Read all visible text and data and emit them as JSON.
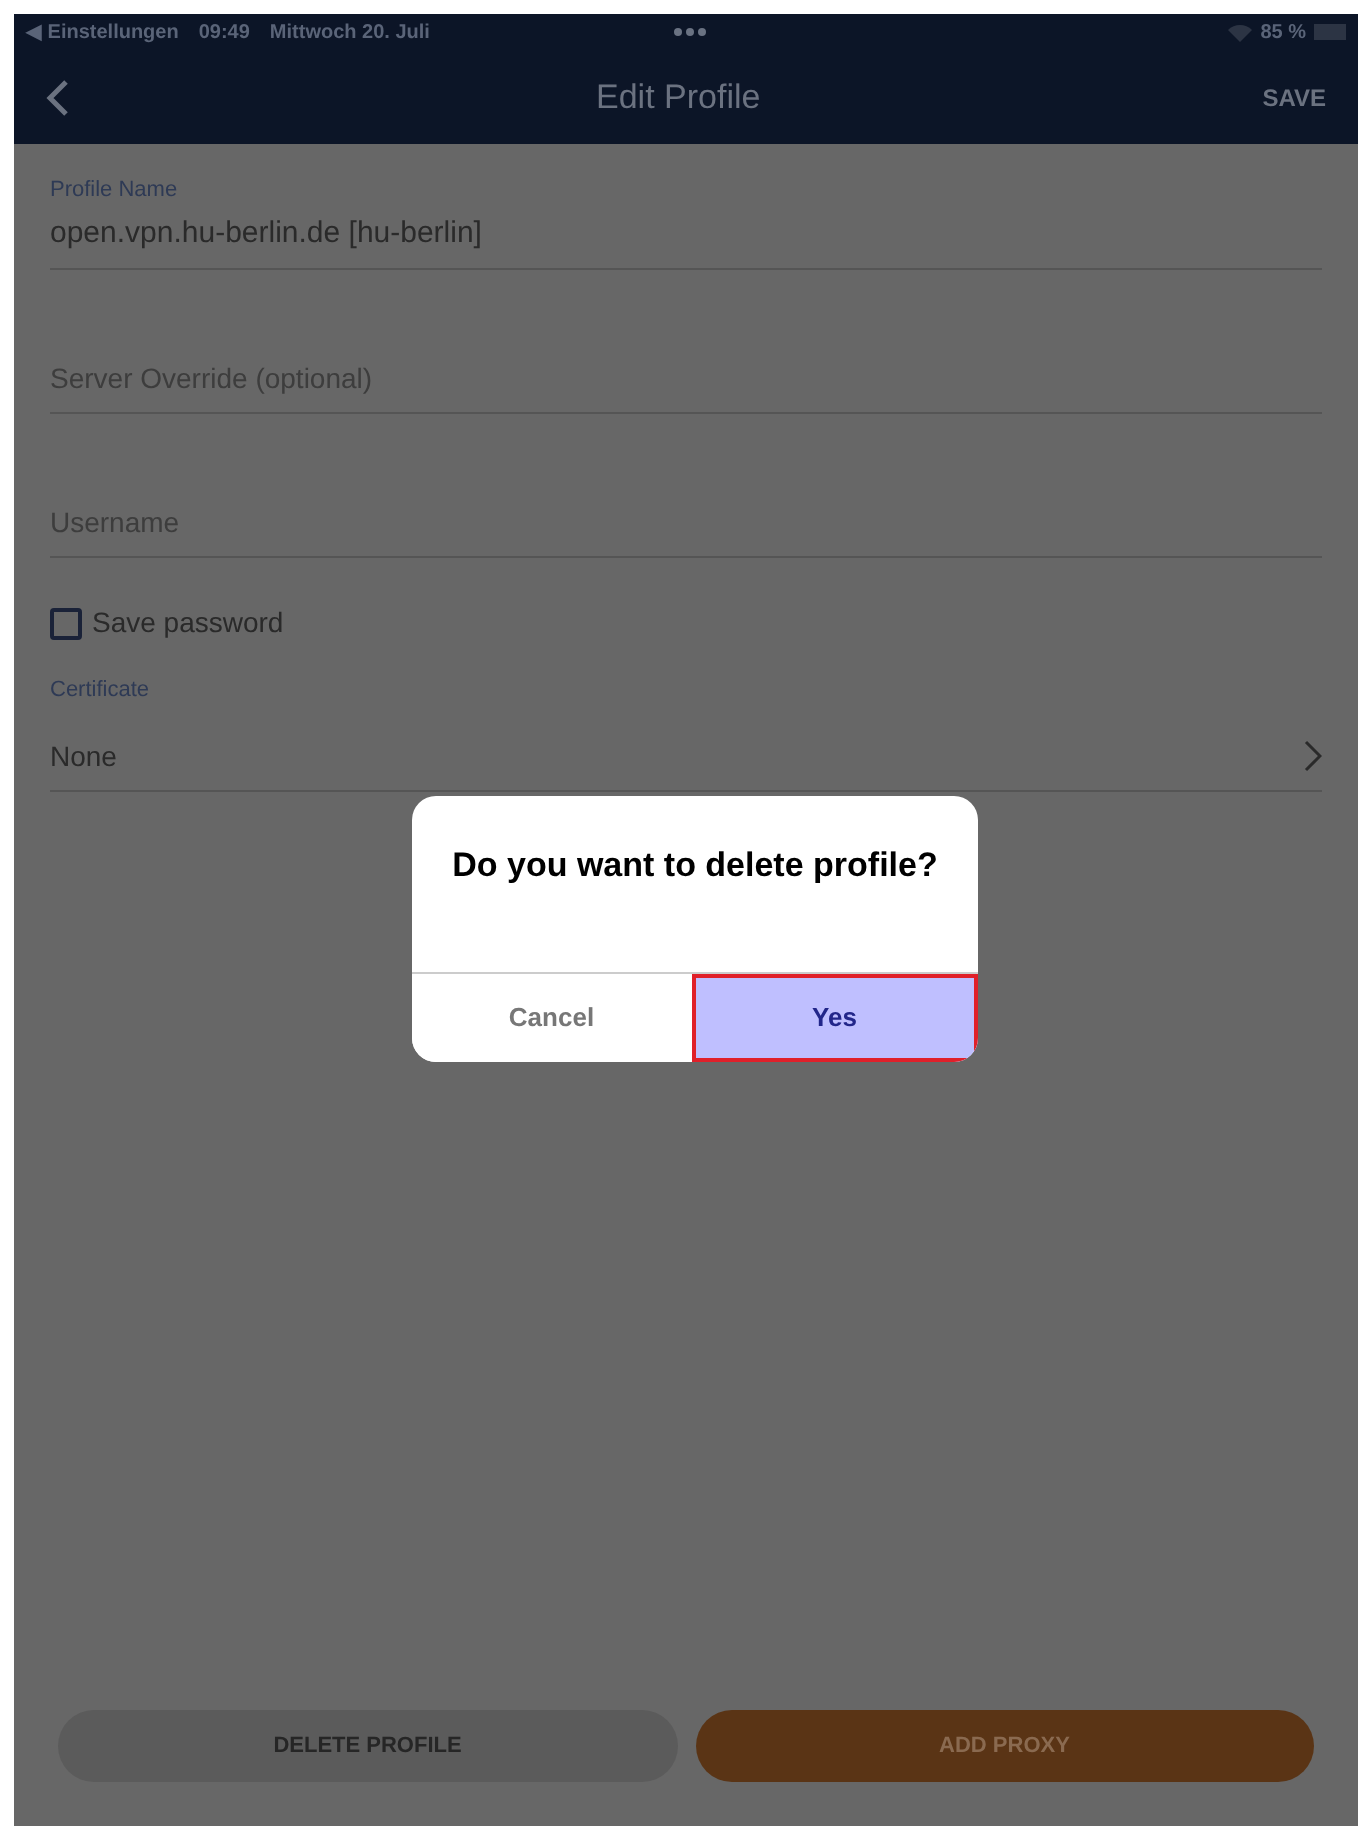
{
  "status_bar": {
    "back_app": "◀ Einstellungen",
    "time": "09:49",
    "date": "Mittwoch 20. Juli",
    "battery": "85 %"
  },
  "nav_bar": {
    "title": "Edit Profile",
    "action": "SAVE"
  },
  "form": {
    "profile_name": {
      "label": "Profile Name",
      "value": "open.vpn.hu-berlin.de [hu-berlin]"
    },
    "server_override": {
      "placeholder": "Server Override (optional)"
    },
    "username": {
      "placeholder": "Username"
    },
    "save_password": {
      "label": "Save password",
      "checked": false
    },
    "certificate": {
      "label": "Certificate",
      "value": "None"
    }
  },
  "dialog": {
    "message": "Do you want to delete profile?",
    "buttons": [
      {
        "label": "Cancel",
        "selected": false
      },
      {
        "label": "Yes",
        "selected": true
      }
    ]
  },
  "bottom_buttons": [
    {
      "kind": "secondary",
      "label": "DELETE PROFILE"
    },
    {
      "kind": "primary",
      "label": "ADD PROXY"
    }
  ]
}
